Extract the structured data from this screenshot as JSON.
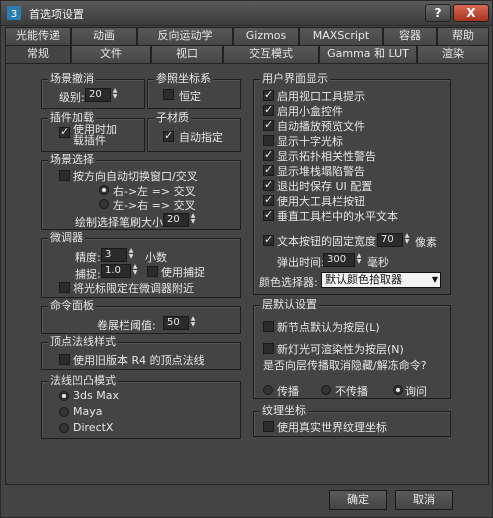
{
  "window": {
    "title": "首选项设置",
    "help_label": "?",
    "close_label": "X"
  },
  "tabs_row1": [
    "光能传递",
    "动画",
    "反向运动学",
    "Gizmos",
    "MAXScript",
    "容器",
    "帮助"
  ],
  "tabs_row2": [
    "常规",
    "文件",
    "视口",
    "交互模式",
    "Gamma 和 LUT",
    "渲染"
  ],
  "scene_undo": {
    "title": "场景撤消",
    "levels_label": "级别:",
    "levels_value": "20"
  },
  "ref_coord": {
    "title": "参照坐标系",
    "constant_label": "恒定"
  },
  "plugin_load": {
    "title": "插件加载",
    "load_on_use_label": "使用时加\n载插件"
  },
  "sub_material": {
    "title": "子材质",
    "auto_assign_label": "自动指定"
  },
  "scene_selection": {
    "title": "场景选择",
    "auto_switch_label": "按方向自动切换窗口/交叉",
    "rtl_label": "右->左 => 交叉",
    "ltr_label": "左->右 => 交叉",
    "brush_size_label": "绘制选择笔刷大小",
    "brush_size_value": "20"
  },
  "spinners": {
    "title": "微调器",
    "precision_label": "精度:",
    "precision_value": "3",
    "decimal_label": "小数",
    "snap_label": "捕捉:",
    "snap_value": "1.0",
    "use_snap_label": "使用捕捉",
    "wrap_cursor_label": "将光标限定在微调器附近"
  },
  "command_panel": {
    "title": "命令面板",
    "rollout_label": "卷展栏阈值:",
    "rollout_value": "50"
  },
  "vertex_normal": {
    "title": "顶点法线样式",
    "legacy_label": "使用旧版本 R4 的顶点法线"
  },
  "normal_bump": {
    "title": "法线凹凸模式",
    "options": [
      "3ds Max",
      "Maya",
      "DirectX"
    ]
  },
  "ui_display": {
    "title": "用户界面显示",
    "items": [
      "启用视口工具提示",
      "启用小盒控件",
      "自动播放预览文件",
      "显示十字光标",
      "显示拓扑相关性警告",
      "显示堆栈塌陷警告",
      "退出时保存 UI 配置",
      "使用大工具栏按钮",
      "垂直工具栏中的水平文本",
      "文本按钮的固定宽度:"
    ],
    "fixed_width_value": "70",
    "pixels_label": "像素",
    "flyout_label": "弹出时间:",
    "flyout_value": "300",
    "ms_label": "毫秒",
    "color_picker_label": "颜色选择器:",
    "color_picker_value": "默认颜色拾取器"
  },
  "layer_defaults": {
    "title": "层默认设置",
    "new_nodes_label": "新节点默认为按层(L)",
    "new_lights_label": "新灯光可渲染性为按层(N)",
    "question_label": "是否向层传播取消隐藏/解冻命令?",
    "propagate_label": "传播",
    "no_propagate_label": "不传播",
    "ask_label": "询问"
  },
  "texture_coords": {
    "title": "纹理坐标",
    "real_world_label": "使用真实世界纹理坐标"
  },
  "footer": {
    "ok_label": "确定",
    "cancel_label": "取消"
  }
}
